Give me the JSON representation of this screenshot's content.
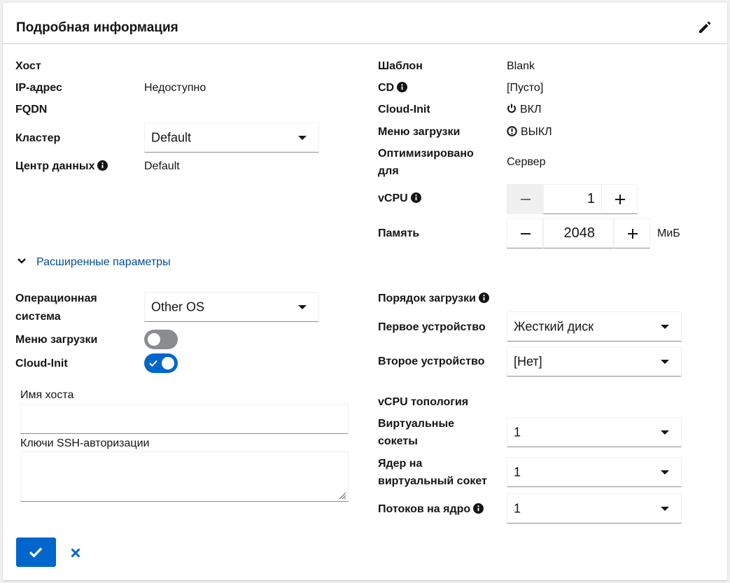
{
  "header": {
    "title": "Подробная информация"
  },
  "left": {
    "host_label": "Хост",
    "ip_label": "IP-адрес",
    "ip_value": "Недоступно",
    "fqdn_label": "FQDN",
    "cluster_label": "Кластер",
    "cluster_value": "Default",
    "datacenter_label": "Центр данных",
    "datacenter_value": "Default"
  },
  "right": {
    "template_label": "Шаблон",
    "template_value": "Blank",
    "cd_label": "CD",
    "cd_value": "[Пусто]",
    "cloudinit_label": "Cloud-Init",
    "cloudinit_value": "ВКЛ",
    "bootmenu_label": "Меню загрузки",
    "bootmenu_value": "ВЫКЛ",
    "optimized_label_1": "Оптимизировано",
    "optimized_label_2": "для",
    "optimized_value": "Сервер",
    "vcpu_label": "vCPU",
    "vcpu_value": "1",
    "memory_label": "Память",
    "memory_value": "2048",
    "memory_unit": "МиБ"
  },
  "advanced": {
    "toggle_label": "Расширенные параметры",
    "os_label_1": "Операционная",
    "os_label_2": "система",
    "os_value": "Other OS",
    "bootmenu_label": "Меню загрузки",
    "bootmenu_on": false,
    "cloudinit_label": "Cloud-Init",
    "cloudinit_on": true,
    "hostname_label": "Имя хоста",
    "hostname_value": "",
    "ssh_label": "Ключи SSH-авторизации",
    "ssh_value": "",
    "boot_order_label": "Порядок загрузки",
    "first_device_label": "Первое устройство",
    "first_device_value": "Жесткий диск",
    "second_device_label": "Второе устройство",
    "second_device_value": "[Нет]",
    "topology_label": "vCPU топология",
    "sockets_label_1": "Виртуальные",
    "sockets_label_2": "сокеты",
    "sockets_value": "1",
    "cores_label_1": "Ядер на",
    "cores_label_2": "виртуальный сокет",
    "cores_value": "1",
    "threads_label": "Потоков на ядро",
    "threads_value": "1"
  },
  "colors": {
    "primary": "#0066cc",
    "link": "#004d99",
    "toggle_off": "#8a8d90"
  }
}
